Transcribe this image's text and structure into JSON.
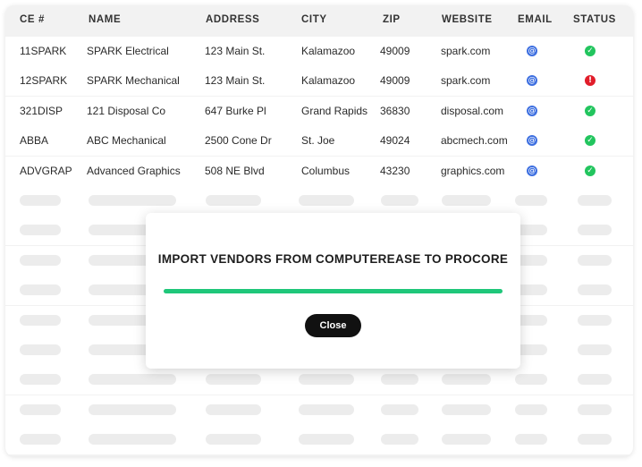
{
  "table": {
    "headers": [
      "CE #",
      "NAME",
      "ADDRESS",
      "CITY",
      "ZIP",
      "WEBSITE",
      "EMAIL",
      "STATUS"
    ],
    "rows": [
      {
        "ce": "11SPARK",
        "name": "SPARK Electrical",
        "address": "123 Main St.",
        "city": "Kalamazoo",
        "zip": "49009",
        "website": "spark.com",
        "email_icon": "email-icon",
        "status": "ok"
      },
      {
        "ce": "12SPARK",
        "name": "SPARK Mechanical",
        "address": "123 Main St.",
        "city": "Kalamazoo",
        "zip": "49009",
        "website": "spark.com",
        "email_icon": "email-icon",
        "status": "error"
      },
      {
        "ce": "321DISP",
        "name": "121 Disposal Co",
        "address": "647 Burke Pl",
        "city": "Grand Rapids",
        "zip": "36830",
        "website": "disposal.com",
        "email_icon": "email-icon",
        "status": "ok"
      },
      {
        "ce": "ABBA",
        "name": "ABC Mechanical",
        "address": "2500 Cone Dr",
        "city": "St. Joe",
        "zip": "49024",
        "website": "abcmech.com",
        "email_icon": "email-icon",
        "status": "ok"
      },
      {
        "ce": "ADVGRAP",
        "name": "Advanced Graphics",
        "address": "508 NE Blvd",
        "city": "Columbus",
        "zip": "43230",
        "website": "graphics.com",
        "email_icon": "email-icon",
        "status": "ok"
      }
    ],
    "placeholder_row_count": 9
  },
  "colors": {
    "status_ok": "#22c55e",
    "status_error": "#e11d2a",
    "email_icon": "#3d6fe0",
    "progress": "#1fc77a"
  },
  "modal": {
    "title": "IMPORT VENDORS FROM COMPUTEREASE TO PROCORE",
    "progress": 1.0,
    "close_label": "Close"
  }
}
